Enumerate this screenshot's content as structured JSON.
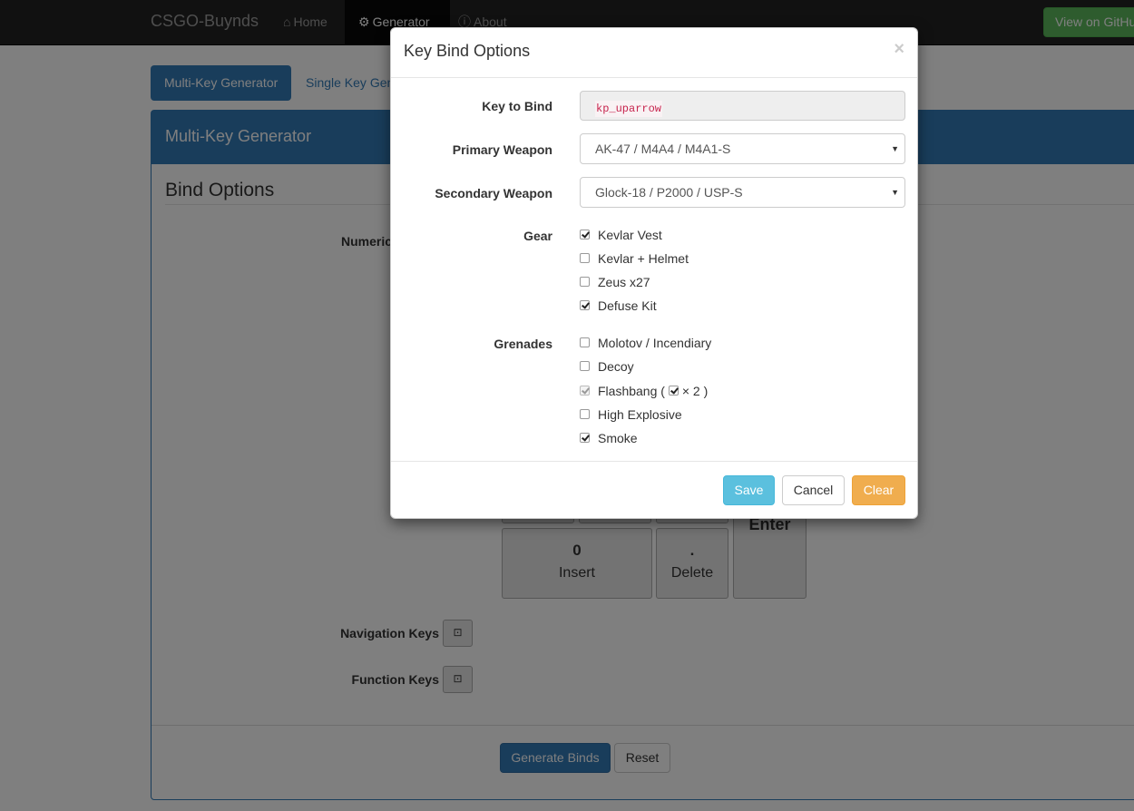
{
  "navbar": {
    "brand": "CSGO-Buynds",
    "items": [
      {
        "label": "Home",
        "icon": "home-icon"
      },
      {
        "label": "Generator",
        "icon": "gear-icon",
        "active": true
      },
      {
        "label": "About",
        "icon": "info-icon"
      }
    ],
    "github_label": "View on GitHub"
  },
  "tabs": [
    {
      "label": "Multi-Key Generator",
      "active": true
    },
    {
      "label": "Single Key Generator"
    }
  ],
  "panel": {
    "heading": "Multi-Key Generator",
    "section_title": "Bind Options",
    "numeric_label": "Numeric Keypad",
    "navigation_label": "Navigation Keys",
    "function_label": "Function Keys",
    "keys": [
      {
        "main": "0",
        "sub": "Insert"
      },
      {
        "main": ".",
        "sub": "Delete"
      },
      {
        "main": "Enter",
        "sub": ""
      }
    ],
    "generate_label": "Generate Binds",
    "reset_label": "Reset"
  },
  "modal": {
    "title": "Key Bind Options",
    "close": "×",
    "key_to_bind_label": "Key to Bind",
    "key_to_bind_value": "kp_uparrow",
    "primary_label": "Primary Weapon",
    "primary_value": "AK-47 / M4A4 / M4A1-S",
    "secondary_label": "Secondary Weapon",
    "secondary_value": "Glock-18 / P2000 / USP-S",
    "gear_label": "Gear",
    "gear": [
      {
        "label": "Kevlar Vest",
        "checked": true
      },
      {
        "label": "Kevlar + Helmet",
        "checked": false
      },
      {
        "label": "Zeus x27",
        "checked": false
      },
      {
        "label": "Defuse Kit",
        "checked": true
      }
    ],
    "grenades_label": "Grenades",
    "grenades": [
      {
        "label": "Molotov / Incendiary",
        "checked": false
      },
      {
        "label": "Decoy",
        "checked": false
      },
      {
        "label": "Flashbang (",
        "checked": true,
        "disabled": true,
        "suffix": "× 2 )",
        "sub_checked": true
      },
      {
        "label": "High Explosive",
        "checked": false
      },
      {
        "label": "Smoke",
        "checked": true
      }
    ],
    "save_label": "Save",
    "cancel_label": "Cancel",
    "clear_label": "Clear"
  },
  "colors": {
    "primary": "#337ab7",
    "info": "#5bc0de",
    "warning": "#f0ad4e",
    "success": "#5cb85c",
    "navbar": "#222222"
  }
}
